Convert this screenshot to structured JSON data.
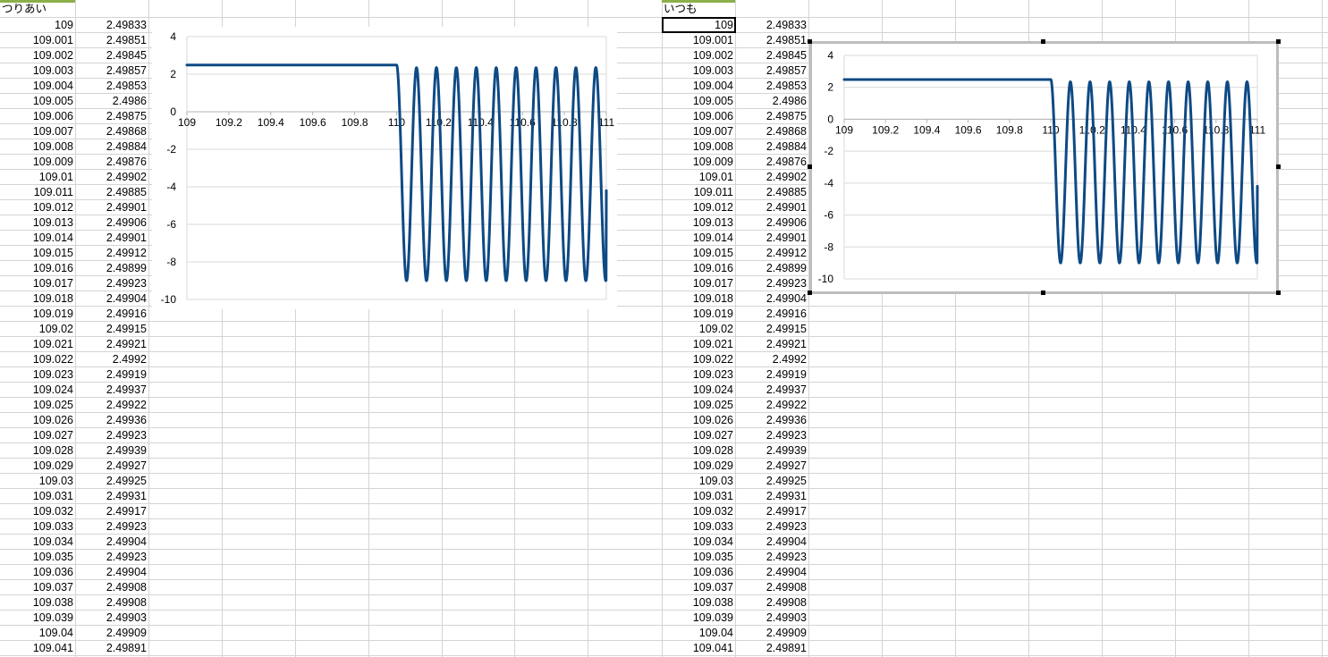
{
  "left": {
    "header": "つりあい",
    "rows": [
      [
        "109",
        "2.49833"
      ],
      [
        "109.001",
        "2.49851"
      ],
      [
        "109.002",
        "2.49845"
      ],
      [
        "109.003",
        "2.49857"
      ],
      [
        "109.004",
        "2.49853"
      ],
      [
        "109.005",
        "2.4986"
      ],
      [
        "109.006",
        "2.49875"
      ],
      [
        "109.007",
        "2.49868"
      ],
      [
        "109.008",
        "2.49884"
      ],
      [
        "109.009",
        "2.49876"
      ],
      [
        "109.01",
        "2.49902"
      ],
      [
        "109.011",
        "2.49885"
      ],
      [
        "109.012",
        "2.49901"
      ],
      [
        "109.013",
        "2.49906"
      ],
      [
        "109.014",
        "2.49901"
      ],
      [
        "109.015",
        "2.49912"
      ],
      [
        "109.016",
        "2.49899"
      ],
      [
        "109.017",
        "2.49923"
      ],
      [
        "109.018",
        "2.49904"
      ],
      [
        "109.019",
        "2.49916"
      ],
      [
        "109.02",
        "2.49915"
      ],
      [
        "109.021",
        "2.49921"
      ],
      [
        "109.022",
        "2.4992"
      ],
      [
        "109.023",
        "2.49919"
      ],
      [
        "109.024",
        "2.49937"
      ],
      [
        "109.025",
        "2.49922"
      ],
      [
        "109.026",
        "2.49936"
      ],
      [
        "109.027",
        "2.49923"
      ],
      [
        "109.028",
        "2.49939"
      ],
      [
        "109.029",
        "2.49927"
      ],
      [
        "109.03",
        "2.49925"
      ],
      [
        "109.031",
        "2.49931"
      ],
      [
        "109.032",
        "2.49917"
      ],
      [
        "109.033",
        "2.49923"
      ],
      [
        "109.034",
        "2.49904"
      ],
      [
        "109.035",
        "2.49923"
      ],
      [
        "109.036",
        "2.49904"
      ],
      [
        "109.037",
        "2.49908"
      ],
      [
        "109.038",
        "2.49908"
      ],
      [
        "109.039",
        "2.49903"
      ],
      [
        "109.04",
        "2.49909"
      ],
      [
        "109.041",
        "2.49891"
      ]
    ]
  },
  "right": {
    "header": "いつも",
    "rows": [
      [
        "109",
        "2.49833"
      ],
      [
        "109.001",
        "2.49851"
      ],
      [
        "109.002",
        "2.49845"
      ],
      [
        "109.003",
        "2.49857"
      ],
      [
        "109.004",
        "2.49853"
      ],
      [
        "109.005",
        "2.4986"
      ],
      [
        "109.006",
        "2.49875"
      ],
      [
        "109.007",
        "2.49868"
      ],
      [
        "109.008",
        "2.49884"
      ],
      [
        "109.009",
        "2.49876"
      ],
      [
        "109.01",
        "2.49902"
      ],
      [
        "109.011",
        "2.49885"
      ],
      [
        "109.012",
        "2.49901"
      ],
      [
        "109.013",
        "2.49906"
      ],
      [
        "109.014",
        "2.49901"
      ],
      [
        "109.015",
        "2.49912"
      ],
      [
        "109.016",
        "2.49899"
      ],
      [
        "109.017",
        "2.49923"
      ],
      [
        "109.018",
        "2.49904"
      ],
      [
        "109.019",
        "2.49916"
      ],
      [
        "109.02",
        "2.49915"
      ],
      [
        "109.021",
        "2.49921"
      ],
      [
        "109.022",
        "2.4992"
      ],
      [
        "109.023",
        "2.49919"
      ],
      [
        "109.024",
        "2.49937"
      ],
      [
        "109.025",
        "2.49922"
      ],
      [
        "109.026",
        "2.49936"
      ],
      [
        "109.027",
        "2.49923"
      ],
      [
        "109.028",
        "2.49939"
      ],
      [
        "109.029",
        "2.49927"
      ],
      [
        "109.03",
        "2.49925"
      ],
      [
        "109.031",
        "2.49931"
      ],
      [
        "109.032",
        "2.49917"
      ],
      [
        "109.033",
        "2.49923"
      ],
      [
        "109.034",
        "2.49904"
      ],
      [
        "109.035",
        "2.49923"
      ],
      [
        "109.036",
        "2.49904"
      ],
      [
        "109.037",
        "2.49908"
      ],
      [
        "109.038",
        "2.49908"
      ],
      [
        "109.039",
        "2.49903"
      ],
      [
        "109.04",
        "2.49909"
      ],
      [
        "109.041",
        "2.49891"
      ]
    ]
  },
  "chart_data": [
    {
      "type": "line",
      "series_color": "#0e4a84",
      "xlim": [
        109,
        111
      ],
      "ylim": [
        -10,
        4
      ],
      "x_ticks": [
        "109",
        "109.2",
        "109.4",
        "109.6",
        "109.8",
        "110",
        "110.2",
        "110.4",
        "110.6",
        "110.8",
        "111"
      ],
      "y_ticks": [
        "4",
        "2",
        "0",
        "-2",
        "-4",
        "-6",
        "-8",
        "-10"
      ],
      "grid": true,
      "flat_segment": {
        "x": [
          109,
          110
        ],
        "y": 2.49
      },
      "oscillation": {
        "x_start": 110,
        "x_end": 111,
        "period": 0.095,
        "max": 2.35,
        "min": -9.0,
        "end_value": -4.2
      }
    },
    {
      "type": "line",
      "series_color": "#0e4a84",
      "xlim": [
        109,
        111
      ],
      "ylim": [
        -10,
        4
      ],
      "x_ticks": [
        "109",
        "109.2",
        "109.4",
        "109.6",
        "109.8",
        "110",
        "110.2",
        "110.4",
        "110.6",
        "110.8",
        "111"
      ],
      "y_ticks": [
        "4",
        "2",
        "0",
        "-2",
        "-4",
        "-6",
        "-8",
        "-10"
      ],
      "grid": true,
      "flat_segment": {
        "x": [
          109,
          110
        ],
        "y": 2.49
      },
      "oscillation": {
        "x_start": 110,
        "x_end": 111,
        "period": 0.095,
        "max": 2.35,
        "min": -9.0,
        "end_value": -4.2
      }
    }
  ]
}
